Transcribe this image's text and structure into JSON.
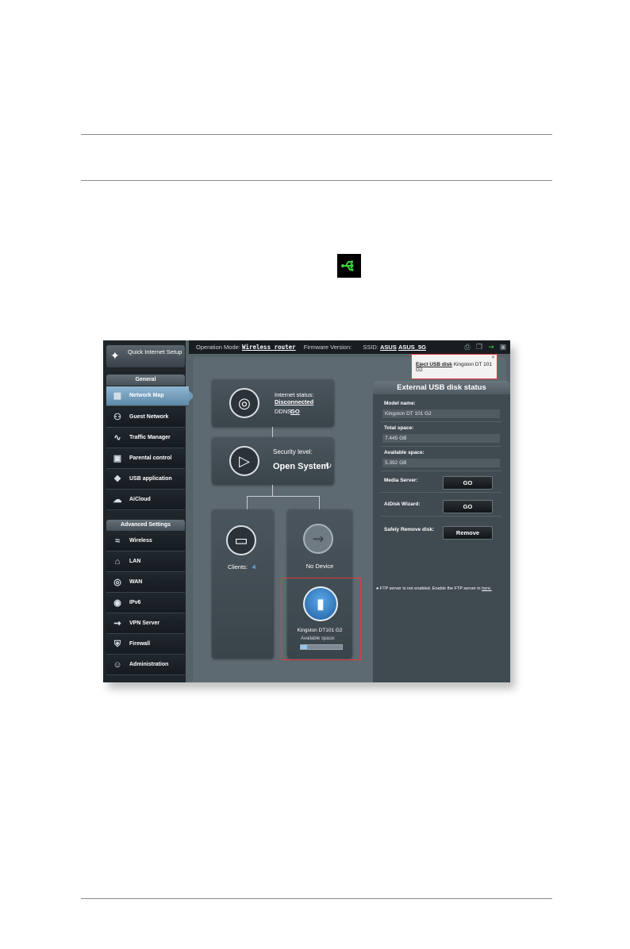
{
  "topbar": {
    "op_mode_label": "Operation Mode:",
    "op_mode_value": "Wireless router",
    "firmware_label": "Firmware Version:",
    "ssid_label": "SSID:",
    "ssid_1": "ASUS",
    "ssid_2": "ASUS_5G"
  },
  "sidebar": {
    "quick_setup": "Quick Internet Setup",
    "general_header": "General",
    "general_items": [
      {
        "label": "Network Map",
        "icon": "network-map-icon"
      },
      {
        "label": "Guest Network",
        "icon": "guest-network-icon"
      },
      {
        "label": "Traffic Manager",
        "icon": "traffic-manager-icon"
      },
      {
        "label": "Parental control",
        "icon": "lock-icon"
      },
      {
        "label": "USB application",
        "icon": "puzzle-icon"
      },
      {
        "label": "AiCloud",
        "icon": "cloud-icon"
      }
    ],
    "advanced_header": "Advanced Settings",
    "advanced_items": [
      {
        "label": "Wireless",
        "icon": "wifi-icon"
      },
      {
        "label": "LAN",
        "icon": "home-icon"
      },
      {
        "label": "WAN",
        "icon": "globe-icon"
      },
      {
        "label": "IPv6",
        "icon": "ipv6-icon"
      },
      {
        "label": "VPN Server",
        "icon": "vpn-icon"
      },
      {
        "label": "Firewall",
        "icon": "shield-icon"
      },
      {
        "label": "Administration",
        "icon": "admin-icon"
      }
    ]
  },
  "map": {
    "internet_status_label": "Internet status:",
    "internet_status_value": "Disconnected",
    "ddns_label": "DDNS:",
    "ddns_link": "GO",
    "security_label": "Security level:",
    "security_value": "Open System",
    "clients_label": "Clients:",
    "clients_count": "4",
    "usb_port_1": "No Device",
    "usb_device_name": "Kingston DT101 G2",
    "usb_available_label": "Available space:",
    "usb_used_fraction": 0.15
  },
  "popup": {
    "eject_label": "Eject USB disk",
    "eject_device": "Kingston DT 101 G2"
  },
  "usb_status": {
    "title": "External USB disk status",
    "model_label": "Model name:",
    "model_value": "Kingston DT 101 G2",
    "total_label": "Total space:",
    "total_value": "7.445 GB",
    "available_label": "Available space:",
    "available_value": "5.392 GB",
    "media_server_label": "Media Server:",
    "media_server_btn": "GO",
    "aidisk_label": "AiDisk Wizard:",
    "aidisk_btn": "GO",
    "remove_label": "Safely Remove disk:",
    "remove_btn": "Remove",
    "ftp_note": "FTP server is not enabled. Enable the FTP server in",
    "ftp_link": "here."
  },
  "colors": {
    "usb_green": "#3bd13b",
    "highlight_red": "#e33b3b",
    "active_blue": "#6e9ab9"
  }
}
